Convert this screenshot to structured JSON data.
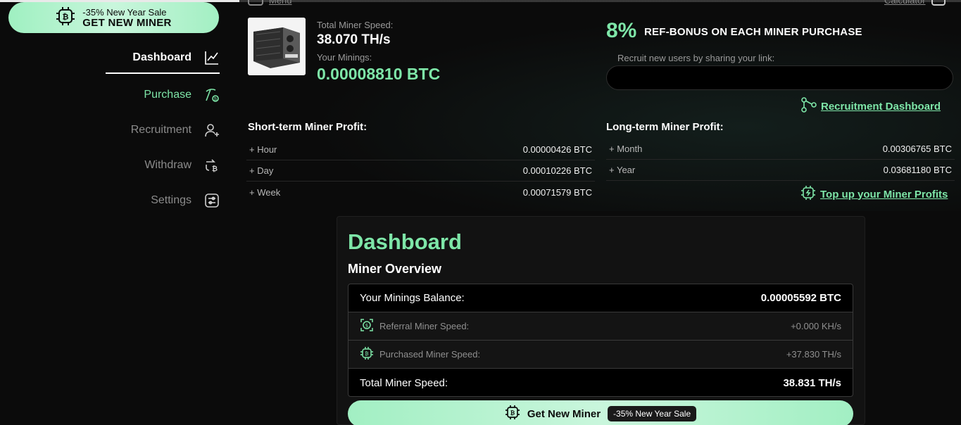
{
  "colors": {
    "accent": "#7ee6a8",
    "background": "#0b0b0b"
  },
  "sale_pill": {
    "line1": "-35% New Year Sale",
    "line2": "GET NEW MINER",
    "icon": "bitcoin-chip-icon"
  },
  "nav": {
    "items": [
      {
        "label": "Dashboard",
        "icon": "chart-line-icon"
      },
      {
        "label": "Purchase",
        "icon": "pickaxe-icon"
      },
      {
        "label": "Recruitment",
        "icon": "user-add-icon"
      },
      {
        "label": "Withdraw",
        "icon": "exchange-bitcoin-icon"
      },
      {
        "label": "Settings",
        "icon": "sliders-icon"
      }
    ]
  },
  "top_links": {
    "menu": "Menu",
    "calculator": "Calculator"
  },
  "miner": {
    "speed_label": "Total Miner Speed:",
    "speed_value": "38.070 TH/s",
    "minings_label": "Your Minings:",
    "minings_value": "0.00008810 BTC"
  },
  "referral": {
    "percent": "8%",
    "headline": "REF-BONUS ON EACH MINER PURCHASE",
    "recruit_label": "Recruit new users by sharing your link:",
    "link_value": "",
    "dashboard_link": "Recruitment Dashboard"
  },
  "short_term": {
    "title": "Short-term Miner Profit:",
    "rows": [
      {
        "label": "+ Hour",
        "value": "0.00000426 BTC"
      },
      {
        "label": "+ Day",
        "value": "0.00010226 BTC"
      },
      {
        "label": "+ Week",
        "value": "0.00071579 BTC"
      }
    ]
  },
  "long_term": {
    "title": "Long-term Miner Profit:",
    "rows": [
      {
        "label": "+ Month",
        "value": "0.00306765 BTC"
      },
      {
        "label": "+ Year",
        "value": "0.03681180 BTC"
      }
    ],
    "topup_link": "Top up your Miner Profits"
  },
  "dashboard": {
    "title": "Dashboard",
    "subtitle": "Miner Overview",
    "rows": [
      {
        "label": "Your Minings Balance:",
        "value": "0.00005592 BTC"
      },
      {
        "label": "Referral Miner Speed:",
        "value": "+0.000 KH/s",
        "icon": "dollar-chip-icon"
      },
      {
        "label": "Purchased Miner Speed:",
        "value": "+37.830 TH/s",
        "icon": "bitcoin-chip-icon"
      },
      {
        "label": "Total Miner Speed:",
        "value": "38.831 TH/s"
      }
    ],
    "button_label": "Get New Miner",
    "button_badge": "-35% New Year Sale"
  }
}
